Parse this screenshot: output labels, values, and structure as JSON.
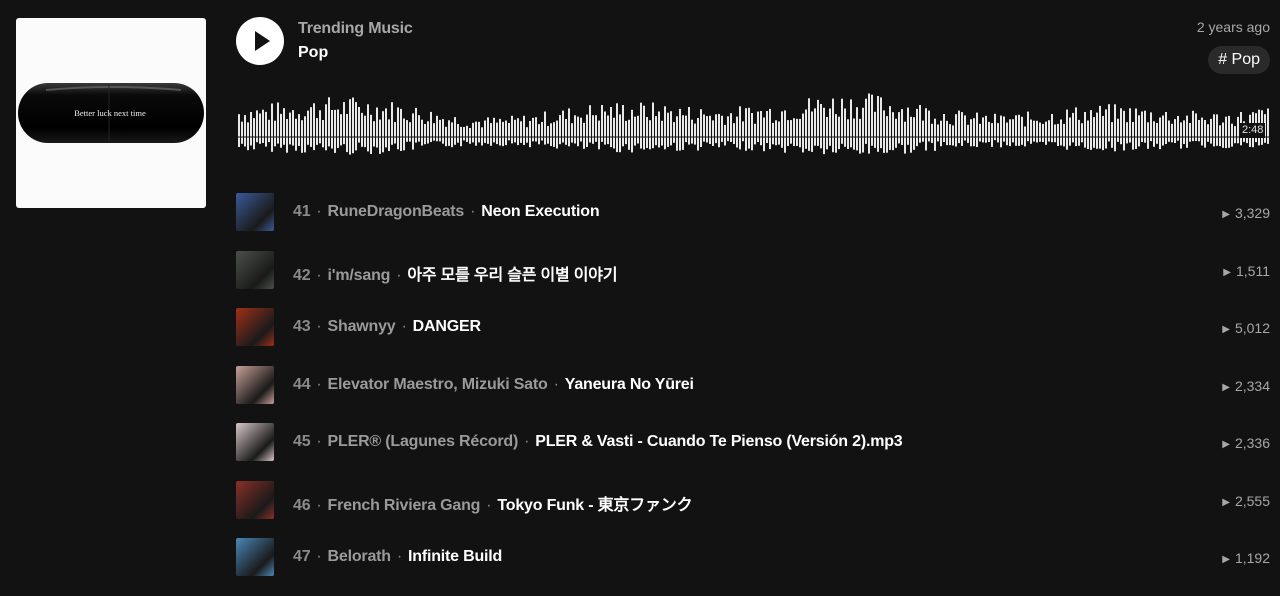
{
  "header": {
    "playlist_name": "Trending Music",
    "genre": "Pop",
    "posted": "2 years ago",
    "tag": "# Pop",
    "duration": "2:48",
    "cover_text": "Better luck next time"
  },
  "tracks": [
    {
      "rank": "41",
      "artist": "RuneDragonBeats",
      "title": "Neon Execution",
      "plays": "3,329",
      "thumb_color": "#3a5a9a"
    },
    {
      "rank": "42",
      "artist": "i'm/sang",
      "title": "아주 모를 우리 슬픈 이별 이야기",
      "plays": "1,511",
      "thumb_color": "#4a5048"
    },
    {
      "rank": "43",
      "artist": "Shawnyy",
      "title": "DANGER",
      "plays": "5,012",
      "thumb_color": "#a03018"
    },
    {
      "rank": "44",
      "artist": "Elevator Maestro, Mizuki Sato",
      "title": "Yaneura No Yūrei",
      "plays": "2,334",
      "thumb_color": "#c8a098"
    },
    {
      "rank": "45",
      "artist": "PLER® (Lagunes Récord)",
      "title": "PLER & Vasti - Cuando Te Pienso (Versión 2).mp3",
      "plays": "2,336",
      "thumb_color": "#d8c8c8"
    },
    {
      "rank": "46",
      "artist": "French Riviera Gang",
      "title": "Tokyo Funk - 東京ファンク",
      "plays": "2,555",
      "thumb_color": "#8a3028"
    },
    {
      "rank": "47",
      "artist": "Belorath",
      "title": "Infinite Build",
      "plays": "1,192",
      "thumb_color": "#4a88b8"
    }
  ]
}
